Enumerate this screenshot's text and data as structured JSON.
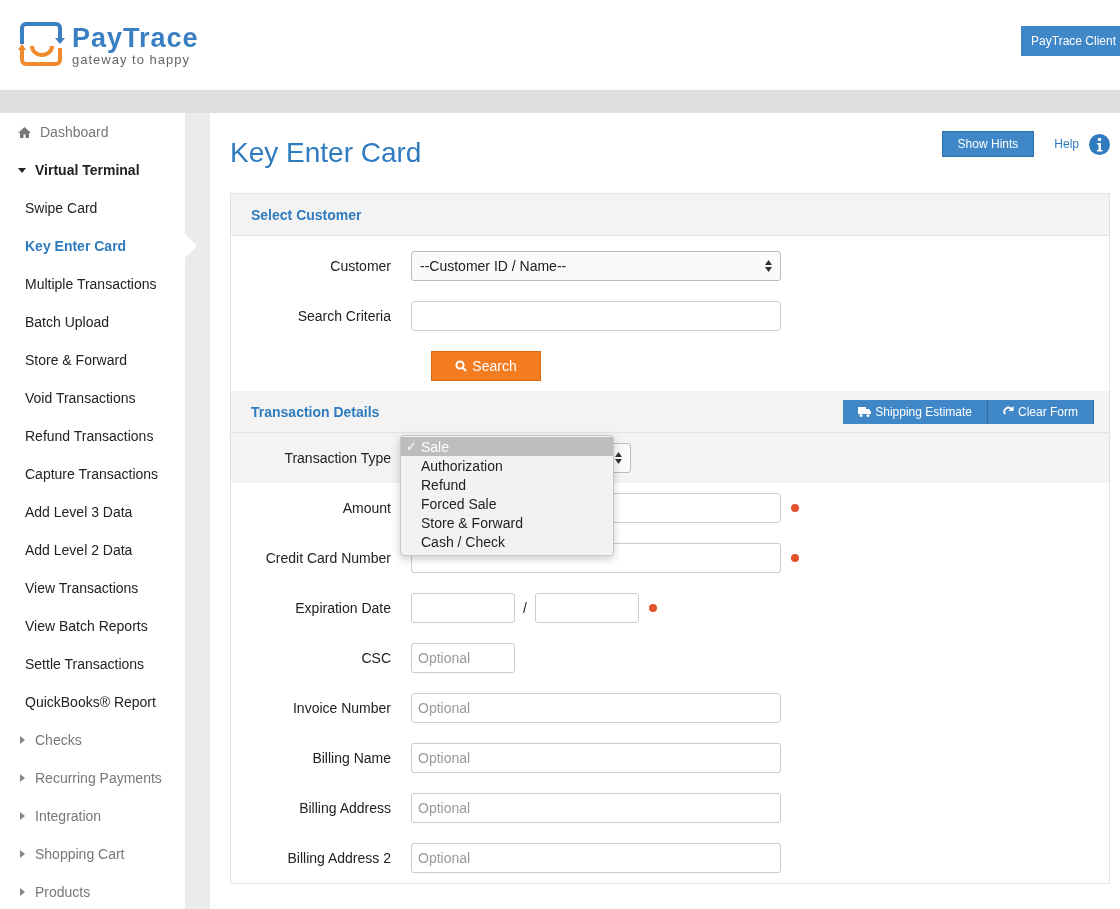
{
  "header": {
    "brand": "PayTrace",
    "tagline": "gateway to happy",
    "account_button": "PayTrace Client"
  },
  "sidebar": {
    "items": [
      {
        "label": "Dashboard",
        "kind": "home"
      },
      {
        "label": "Virtual Terminal",
        "kind": "group",
        "expanded": true,
        "children": [
          {
            "label": "Swipe Card",
            "selected": false
          },
          {
            "label": "Key Enter Card",
            "selected": true
          },
          {
            "label": "Multiple Transactions",
            "selected": false
          },
          {
            "label": "Batch Upload",
            "selected": false
          },
          {
            "label": "Store & Forward",
            "selected": false
          },
          {
            "label": "Void Transactions",
            "selected": false
          },
          {
            "label": "Refund Transactions",
            "selected": false
          },
          {
            "label": "Capture Transactions",
            "selected": false
          },
          {
            "label": "Add Level 3 Data",
            "selected": false
          },
          {
            "label": "Add Level 2 Data",
            "selected": false
          },
          {
            "label": "View Transactions",
            "selected": false
          },
          {
            "label": "View Batch Reports",
            "selected": false
          },
          {
            "label": "Settle Transactions",
            "selected": false
          },
          {
            "label": "QuickBooks® Report",
            "selected": false
          }
        ]
      },
      {
        "label": "Checks",
        "kind": "group",
        "expanded": false
      },
      {
        "label": "Recurring Payments",
        "kind": "group",
        "expanded": false
      },
      {
        "label": "Integration",
        "kind": "group",
        "expanded": false
      },
      {
        "label": "Shopping Cart",
        "kind": "group",
        "expanded": false
      },
      {
        "label": "Products",
        "kind": "group",
        "expanded": false
      }
    ]
  },
  "page": {
    "title": "Key Enter Card",
    "hints_button": "Show Hints",
    "help_link": "Help"
  },
  "sections": [
    {
      "title": "Select Customer",
      "rows": [
        {
          "kind": "select",
          "label": "Customer",
          "value": "--Customer ID / Name--"
        },
        {
          "kind": "text",
          "label": "Search Criteria",
          "highlighted": false,
          "required": false
        },
        {
          "kind": "button",
          "button": "Search"
        }
      ]
    },
    {
      "title": "Transaction Details",
      "actions": [
        {
          "label": "Shipping Estimate",
          "kind": "shipping"
        },
        {
          "label": "Clear Form",
          "kind": "reset"
        }
      ],
      "rows": [
        {
          "kind": "dropdown",
          "label": "Transaction Type",
          "highlighted": true,
          "options": [
            {
              "label": "Sale",
              "selected": true
            },
            {
              "label": "Authorization",
              "selected": false
            },
            {
              "label": "Refund",
              "selected": false
            },
            {
              "label": "Forced Sale",
              "selected": false
            },
            {
              "label": "Store & Forward",
              "selected": false
            },
            {
              "label": "Cash / Check",
              "selected": false
            }
          ],
          "check": "✓"
        },
        {
          "kind": "text",
          "label": "Amount",
          "highlighted": false,
          "required": true
        },
        {
          "kind": "text",
          "label": "Credit Card Number",
          "highlighted": false,
          "required": true
        },
        {
          "kind": "date",
          "label": "Expiration Date",
          "separator": "/",
          "highlighted": false,
          "required": true
        },
        {
          "kind": "short",
          "label": "CSC",
          "placeholder": "Optional",
          "highlighted": false,
          "required": false
        },
        {
          "kind": "text",
          "label": "Invoice Number",
          "placeholder": "Optional",
          "highlighted": false,
          "required": false
        },
        {
          "kind": "text",
          "label": "Billing Name",
          "placeholder": "Optional",
          "highlighted": false,
          "required": false
        },
        {
          "kind": "text",
          "label": "Billing Address",
          "placeholder": "Optional",
          "highlighted": false,
          "required": false
        },
        {
          "kind": "text",
          "label": "Billing Address 2",
          "placeholder": "Optional",
          "highlighted": false,
          "required": false
        }
      ]
    }
  ]
}
